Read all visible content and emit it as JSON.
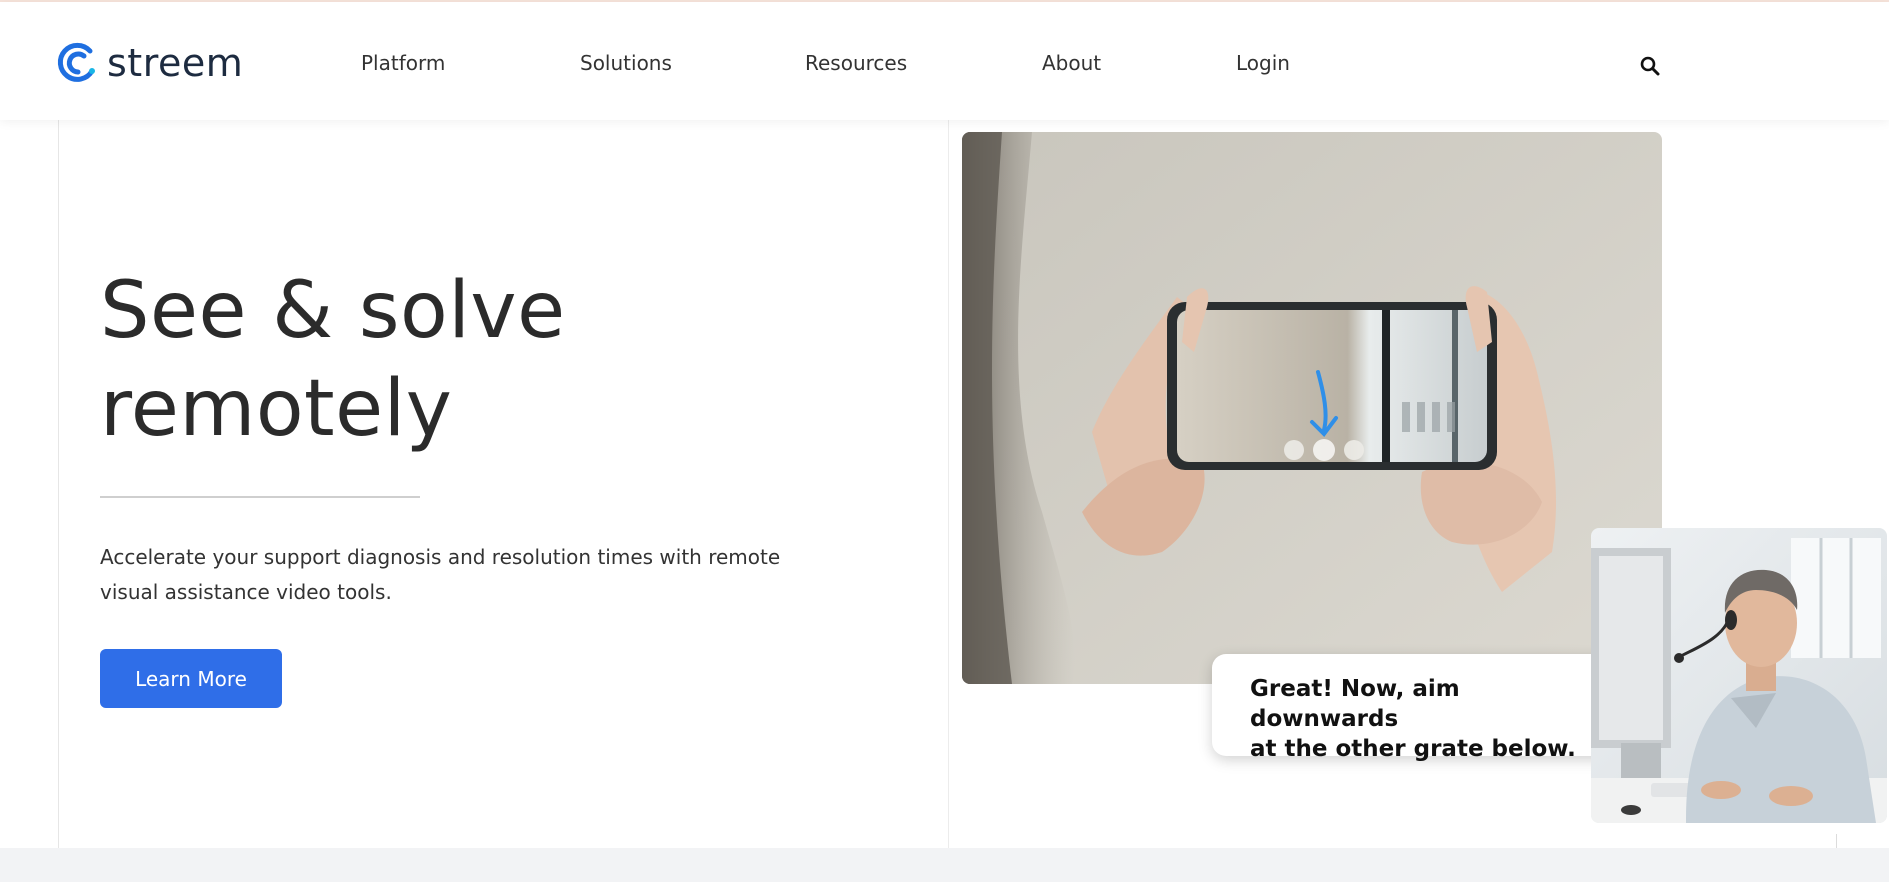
{
  "brand": {
    "name": "streem",
    "accent_color": "#2f6ee8",
    "logo_colors": [
      "#1f6fe0",
      "#19b6e6"
    ]
  },
  "nav": {
    "items": [
      "Platform",
      "Solutions",
      "Resources",
      "About",
      "Login"
    ],
    "search_icon": "search-icon"
  },
  "hero": {
    "title_line1": "See & solve",
    "title_line2": "remotely",
    "description": "Accelerate your support diagnosis and resolution times with remote visual assistance video tools.",
    "cta_label": "Learn More"
  },
  "bubble": {
    "line1": "Great! Now, aim downwards",
    "line2": "at the other grate below."
  }
}
